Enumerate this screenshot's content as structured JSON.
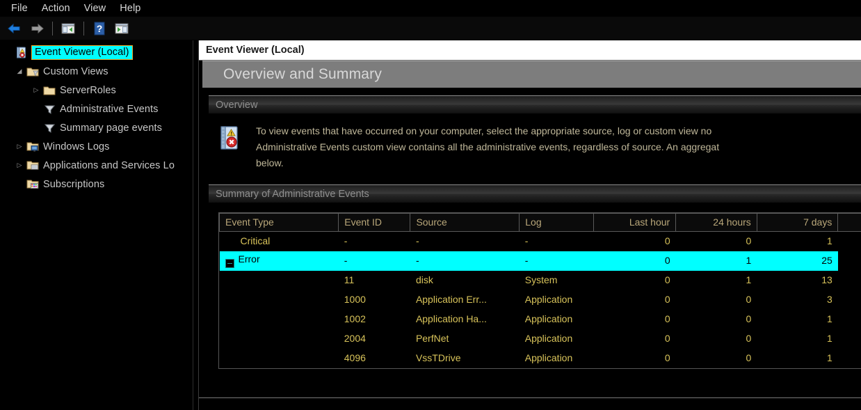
{
  "menubar": {
    "items": [
      {
        "label": "File",
        "name": "menu-file"
      },
      {
        "label": "Action",
        "name": "menu-action"
      },
      {
        "label": "View",
        "name": "menu-view"
      },
      {
        "label": "Help",
        "name": "menu-help"
      }
    ]
  },
  "toolbar": {
    "buttons": [
      {
        "icon": "back-arrow-icon",
        "label": "Back"
      },
      {
        "icon": "forward-arrow-icon",
        "label": "Forward"
      },
      {
        "icon": "show-console-tree-icon",
        "label": "Show/Hide Console Tree"
      },
      {
        "icon": "help-icon",
        "label": "Help"
      },
      {
        "icon": "show-action-pane-icon",
        "label": "Show/Hide Action Pane"
      }
    ]
  },
  "tree": {
    "items": [
      {
        "label": "Event Viewer (Local)",
        "icon": "event-viewer-book-icon",
        "indent": 0,
        "expander": "",
        "selected": true
      },
      {
        "label": "Custom Views",
        "icon": "custom-views-folder-icon",
        "indent": 1,
        "expander": "expanded",
        "selected": false
      },
      {
        "label": "ServerRoles",
        "icon": "folder-icon",
        "indent": 2,
        "expander": "collapsed",
        "selected": false
      },
      {
        "label": "Administrative Events",
        "icon": "filter-funnel-icon",
        "indent": 2,
        "expander": "",
        "selected": false
      },
      {
        "label": "Summary page events",
        "icon": "filter-funnel-icon",
        "indent": 2,
        "expander": "",
        "selected": false
      },
      {
        "label": "Windows Logs",
        "icon": "windows-logs-folder-icon",
        "indent": 1,
        "expander": "collapsed",
        "selected": false
      },
      {
        "label": "Applications and Services Lo",
        "icon": "app-services-folder-icon",
        "indent": 1,
        "expander": "collapsed",
        "selected": false
      },
      {
        "label": "Subscriptions",
        "icon": "subscriptions-folder-icon",
        "indent": 1,
        "expander": "",
        "selected": false
      }
    ]
  },
  "content": {
    "header_title": "Event Viewer (Local)",
    "page_title": "Overview and Summary",
    "overview": {
      "section_title": "Overview",
      "icon": "event-viewer-book-icon",
      "line1": "To view events that have occurred on your computer, select the appropriate source, log or custom view no",
      "line2": "Administrative Events custom view contains all the administrative events, regardless of source. An aggregat",
      "line3": "below."
    },
    "summary": {
      "section_title": "Summary of Administrative Events",
      "columns": [
        "Event Type",
        "Event ID",
        "Source",
        "Log",
        "Last hour",
        "24 hours",
        "7 days",
        ""
      ],
      "rows": [
        {
          "event_type": "Critical",
          "event_id": "-",
          "source": "-",
          "log": "-",
          "last_hour": "0",
          "hours_24": "0",
          "days_7": "1",
          "level": "group",
          "selected": false,
          "expander": ""
        },
        {
          "event_type": "Error",
          "event_id": "-",
          "source": "-",
          "log": "-",
          "last_hour": "0",
          "hours_24": "1",
          "days_7": "25",
          "level": "group",
          "selected": true,
          "expander": "minus"
        },
        {
          "event_type": "",
          "event_id": "11",
          "source": "disk",
          "log": "System",
          "last_hour": "0",
          "hours_24": "1",
          "days_7": "13",
          "level": "child",
          "selected": false,
          "expander": ""
        },
        {
          "event_type": "",
          "event_id": "1000",
          "source": "Application Err...",
          "log": "Application",
          "last_hour": "0",
          "hours_24": "0",
          "days_7": "3",
          "level": "child",
          "selected": false,
          "expander": ""
        },
        {
          "event_type": "",
          "event_id": "1002",
          "source": "Application Ha...",
          "log": "Application",
          "last_hour": "0",
          "hours_24": "0",
          "days_7": "1",
          "level": "child",
          "selected": false,
          "expander": ""
        },
        {
          "event_type": "",
          "event_id": "2004",
          "source": "PerfNet",
          "log": "Application",
          "last_hour": "0",
          "hours_24": "0",
          "days_7": "1",
          "level": "child",
          "selected": false,
          "expander": ""
        },
        {
          "event_type": "",
          "event_id": "4096",
          "source": "VssTDrive",
          "log": "Application",
          "last_hour": "0",
          "hours_24": "0",
          "days_7": "1",
          "level": "child",
          "selected": false,
          "expander": ""
        }
      ]
    }
  },
  "colors": {
    "selection_cyan": "#00ffff",
    "text_gold": "#d8c35a",
    "header_gold": "#b9a77a",
    "body_gold": "#c0b89a",
    "tree_text": "#c8c8c8",
    "background": "#000000",
    "title_bar_grey": "#7d7d7d"
  }
}
